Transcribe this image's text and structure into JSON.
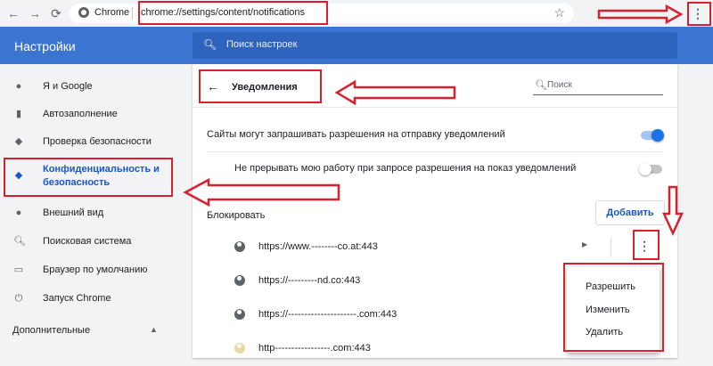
{
  "browser": {
    "brand": "Chrome",
    "url": "chrome://settings/content/notifications",
    "back_icon": "←",
    "forward_icon": "→",
    "reload_icon": "⟳",
    "star_icon": "☆",
    "menu_icon": "⋮"
  },
  "header": {
    "title": "Настройки",
    "search_placeholder": "Поиск настроек"
  },
  "sidebar": {
    "items": [
      {
        "label": "Я и Google",
        "icon": "person-icon"
      },
      {
        "label": "Автозаполнение",
        "icon": "clipboard-icon"
      },
      {
        "label": "Проверка безопасности",
        "icon": "shield-check-icon"
      },
      {
        "label": "Конфиденциальность и безопасность",
        "icon": "shield-icon",
        "active": true
      },
      {
        "label": "Внешний вид",
        "icon": "palette-icon"
      },
      {
        "label": "Поисковая система",
        "icon": "search-icon"
      },
      {
        "label": "Браузер по умолчанию",
        "icon": "browser-icon"
      },
      {
        "label": "Запуск Chrome",
        "icon": "power-icon"
      }
    ],
    "more_label": "Дополнительные"
  },
  "main": {
    "title": "Уведомления",
    "search_placeholder": "Поиск",
    "setting1_label": "Сайты могут запрашивать разрешения на отправку уведомлений",
    "setting1_on": true,
    "setting2_label": "Не прерывать мою работу при запросе разрешения на показ уведомлений",
    "setting2_on": false,
    "block_label": "Блокировать",
    "add_button": "Добавить",
    "sites": [
      "https://www.--------co.at:443",
      "https://---------nd.co:443",
      "https://---------------------.com:443",
      "http-----------------.com:443"
    ]
  },
  "popup_menu": {
    "items": [
      "Разрешить",
      "Изменить",
      "Удалить"
    ]
  },
  "colors": {
    "header_blue": "#3c74d1",
    "accent_blue": "#1a73e8",
    "annotation_red": "#d9202c"
  }
}
